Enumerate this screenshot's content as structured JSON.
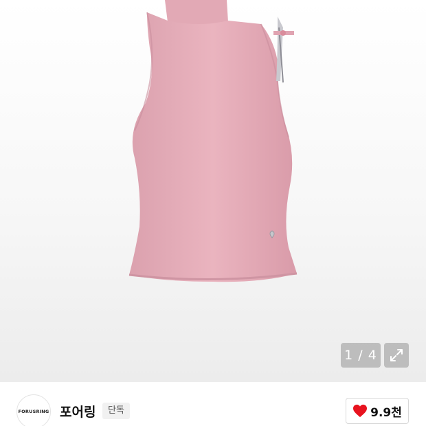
{
  "gallery": {
    "image_description_icon": "pink-sleeveless-mock-neck-top",
    "counter": "1 / 4",
    "expand_icon": "expand-arrows-icon"
  },
  "brand": {
    "logo_text": "FORUSRING",
    "name": "포어링",
    "badge": "단독"
  },
  "likes": {
    "icon": "heart-icon",
    "count": "9.9천",
    "color": "#e8131f"
  }
}
